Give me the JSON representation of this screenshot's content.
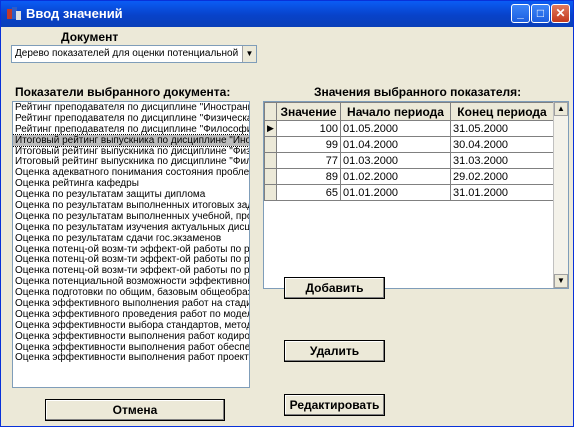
{
  "window": {
    "title": "Ввод значений"
  },
  "document_section": {
    "label": "Документ",
    "selected": "Дерево показателей для оценки потенциальной возможности эффективной работы"
  },
  "indicators": {
    "label": "Показатели выбранного документа:",
    "items": [
      "Рейтинг преподавателя по дисциплине \"Иностранный язык\"",
      "Рейтинг преподавателя по дисциплине \"Физическая культура\"",
      "Рейтинг преподавателя по дисциплине \"Философия\"",
      "Итоговый рейтинг выпускника по дисциплине \"Иностранный язык\"",
      "Итоговый рейтинг выпускника по дисциплине \"Физическая культура\"",
      "Итоговый рейтинг выпускника по дисциплине \"Философия\"",
      "Оценка адекватного понимания состояния проблемы",
      "Оценка рейтинга кафедры",
      "Оценка по  результатам защиты диплома",
      "Оценка по результатам выполненных итоговых заданий",
      "Оценка по результатам выполненных учебной, производственной практики",
      "Оценка по результатам изучения актуальных дисциплин",
      "Оценка по результатам сдачи гос.экзаменов",
      "Оценка потенц-ой возм-ти эффект-ой работы по разработке",
      "Оценка потенц-ой возм-ти эффект-ой работы по разработке проектов",
      "Оценка потенц-ой возм-ти эффект-ой работы по разработке систем",
      "Оценка потенциальной возможности эффективной работы",
      "Оценка подготовки по общим, базовым общеобразовательным",
      "Оценка эффективного выполнения работ на стадии анализа",
      "Оценка эффективного проведения работ по моделированию",
      "Оценка эффективности выбора стандартов, методов, средств",
      "Оценка эффективности выполнения  работ кодирования",
      "Оценка эффективности выполнения  работ обеспечения",
      "Оценка эффективности выполнения  работ проектирования"
    ],
    "selected_index": 3
  },
  "values": {
    "label": "Значения выбранного показателя:",
    "columns": [
      "Значение",
      "Начало периода",
      "Конец периода"
    ],
    "rows": [
      {
        "value": "100",
        "start": "01.05.2000",
        "end": "31.05.2000",
        "indicator": "▶"
      },
      {
        "value": "99",
        "start": "01.04.2000",
        "end": "30.04.2000",
        "indicator": ""
      },
      {
        "value": "77",
        "start": "01.03.2000",
        "end": "31.03.2000",
        "indicator": ""
      },
      {
        "value": "89",
        "start": "01.02.2000",
        "end": "29.02.2000",
        "indicator": ""
      },
      {
        "value": "65",
        "start": "01.01.2000",
        "end": "31.01.2000",
        "indicator": ""
      }
    ]
  },
  "buttons": {
    "add": "Добавить",
    "delete": "Удалить",
    "edit": "Редактировать",
    "cancel": "Отмена"
  },
  "icons": {
    "app": "app-icon",
    "minimize": "minimize-icon",
    "maximize": "maximize-icon",
    "close": "close-icon"
  }
}
